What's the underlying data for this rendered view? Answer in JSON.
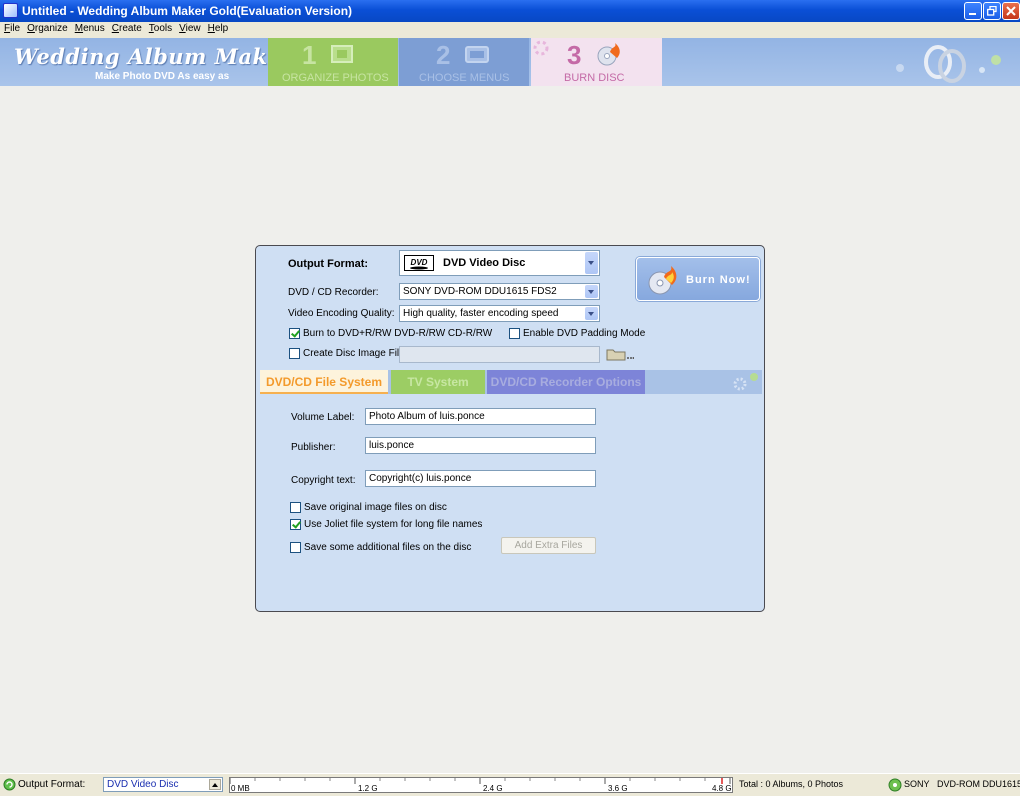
{
  "window": {
    "title": "Untitled - Wedding Album Maker Gold(Evaluation Version)"
  },
  "menu": [
    "File",
    "Organize",
    "Menus",
    "Create",
    "Tools",
    "View",
    "Help"
  ],
  "banner": {
    "logo": "Wedding Album Maker Gold",
    "tagline": "Make Photo DVD As easy as",
    "steps": [
      {
        "num": "1",
        "label": "ORGANIZE PHOTOS"
      },
      {
        "num": "2",
        "label": "CHOOSE MENUS"
      },
      {
        "num": "3",
        "label": "BURN DISC"
      }
    ]
  },
  "panel": {
    "output_format_label": "Output Format:",
    "output_format_value": "DVD Video Disc",
    "recorder_label": "DVD / CD Recorder:",
    "recorder_value": "SONY     DVD-ROM DDU1615  FDS2",
    "quality_label": "Video Encoding Quality:",
    "quality_value": "High quality, faster encoding speed",
    "burn_to_label": "Burn to DVD+R/RW DVD-R/RW CD-R/RW",
    "burn_to_checked": true,
    "padding_label": "Enable DVD Padding Mode",
    "padding_checked": false,
    "image_file_label": "Create Disc Image File:",
    "image_file_checked": false,
    "burn_now": "Burn Now!",
    "tabs": [
      "DVD/CD File System",
      "TV System",
      "DVD/CD Recorder Options"
    ],
    "volume_label_label": "Volume Label:",
    "volume_label_value": "Photo Album of luis.ponce",
    "publisher_label": "Publisher:",
    "publisher_value": "luis.ponce",
    "copyright_label": "Copyright text:",
    "copyright_value": "Copyright(c) luis.ponce",
    "save_original_label": "Save original image files on disc",
    "joliet_label": "Use Joliet file system for long file names",
    "additional_label": "Save some additional files on the disc",
    "add_extra_button": "Add Extra Files"
  },
  "status": {
    "output_label": "Output Format:",
    "output_value": "DVD Video Disc",
    "scale": [
      "0 MB",
      "1.2 G",
      "2.4 G",
      "3.6 G",
      "4.8 G"
    ],
    "total": "Total : 0 Albums, 0 Photos",
    "drive_vendor": "SONY",
    "drive_model": "DVD-ROM DDU1615"
  }
}
